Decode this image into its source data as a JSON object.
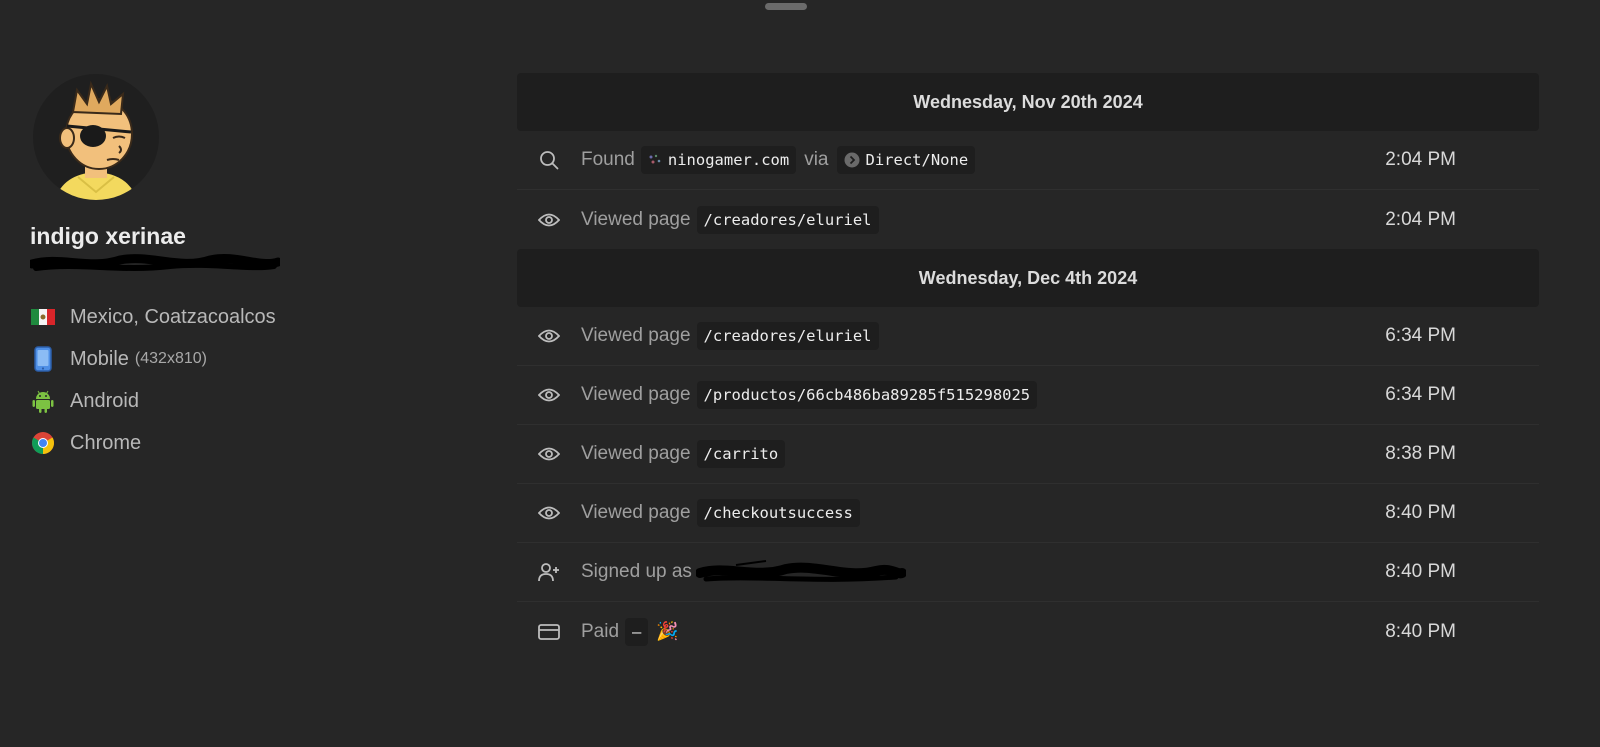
{
  "profile": {
    "name": "indigo xerinae",
    "facts": [
      {
        "icon": "mexico-flag-icon",
        "label": "Mexico, Coatzacoalcos",
        "sub": ""
      },
      {
        "icon": "mobile-phone-icon",
        "label": "Mobile",
        "sub": "(432x810)"
      },
      {
        "icon": "android-icon",
        "label": "Android",
        "sub": ""
      },
      {
        "icon": "chrome-icon",
        "label": "Chrome",
        "sub": ""
      }
    ]
  },
  "timeline": {
    "day1": {
      "header": "Wednesday, Nov 20th 2024",
      "events": [
        {
          "icon": "search-icon",
          "action": "Found",
          "chip": "ninogamer.com",
          "via": "via",
          "chip2": "Direct/None",
          "time": "2:04 PM"
        },
        {
          "icon": "eye-icon",
          "action": "Viewed page",
          "chip": "/creadores/eluriel",
          "time": "2:04 PM"
        }
      ]
    },
    "day2": {
      "header": "Wednesday, Dec 4th 2024",
      "events": [
        {
          "icon": "eye-icon",
          "action": "Viewed page",
          "chip": "/creadores/eluriel",
          "time": "6:34 PM"
        },
        {
          "icon": "eye-icon",
          "action": "Viewed page",
          "chip": "/productos/66cb486ba89285f515298025",
          "time": "6:34 PM"
        },
        {
          "icon": "eye-icon",
          "action": "Viewed page",
          "chip": "/carrito",
          "time": "8:38 PM"
        },
        {
          "icon": "eye-icon",
          "action": "Viewed page",
          "chip": "/checkoutsuccess",
          "time": "8:40 PM"
        },
        {
          "icon": "user-plus-icon",
          "action": "Signed up as",
          "time": "8:40 PM"
        },
        {
          "icon": "credit-card-icon",
          "action": "Paid",
          "chip": "–",
          "emoji": "🎉",
          "time": "8:40 PM"
        }
      ]
    }
  },
  "colors": {
    "background": "#262626",
    "header_bg": "#1e1e1e",
    "chip_bg": "#1e1e1e"
  }
}
